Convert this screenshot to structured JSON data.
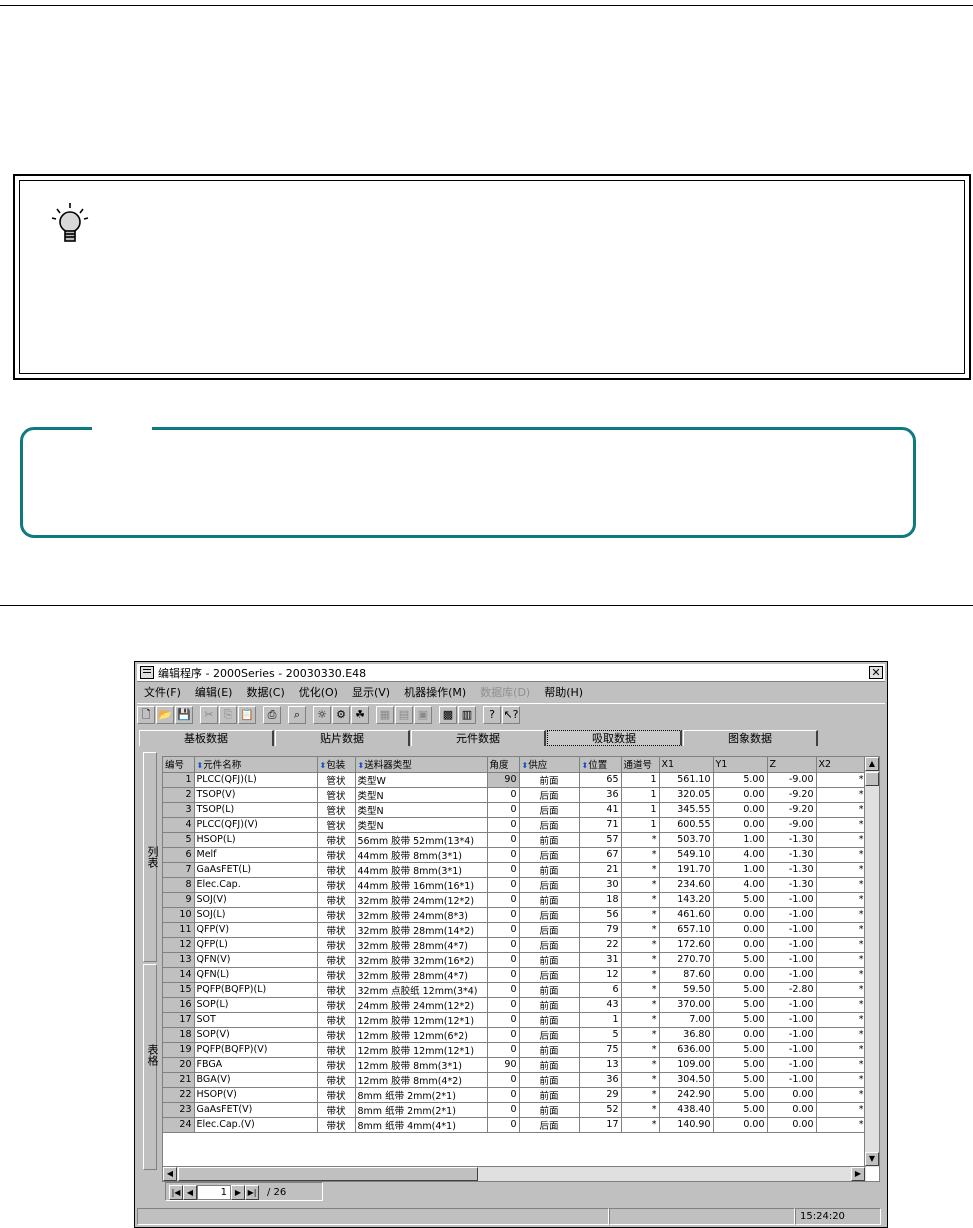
{
  "window": {
    "title": "编辑程序 - 2000Series - 20030330.E48",
    "close_label": "✕"
  },
  "menu": [
    {
      "label": "文件(F)",
      "enabled": true
    },
    {
      "label": "编辑(E)",
      "enabled": true
    },
    {
      "label": "数据(C)",
      "enabled": true
    },
    {
      "label": "优化(O)",
      "enabled": true
    },
    {
      "label": "显示(V)",
      "enabled": true
    },
    {
      "label": "机器操作(M)",
      "enabled": true
    },
    {
      "label": "数据库(D)",
      "enabled": false
    },
    {
      "label": "帮助(H)",
      "enabled": true
    }
  ],
  "toolbar": [
    {
      "name": "new-file-icon",
      "glyph": "🗋",
      "enabled": true
    },
    {
      "name": "open-folder-icon",
      "glyph": "📂",
      "enabled": true
    },
    {
      "name": "save-icon",
      "glyph": "💾",
      "enabled": true
    },
    {
      "sep": true
    },
    {
      "name": "cut-icon",
      "glyph": "✂",
      "enabled": false
    },
    {
      "name": "copy-icon",
      "glyph": "⎘",
      "enabled": false
    },
    {
      "name": "paste-icon",
      "glyph": "📋",
      "enabled": false
    },
    {
      "sep": true
    },
    {
      "name": "print-icon",
      "glyph": "⎙",
      "enabled": true
    },
    {
      "sep": true
    },
    {
      "name": "find-icon",
      "glyph": "⌕",
      "enabled": true
    },
    {
      "sep": true
    },
    {
      "name": "idea-bulb-icon",
      "glyph": "☼",
      "enabled": true
    },
    {
      "name": "optimize-icon",
      "glyph": "⚙",
      "enabled": true
    },
    {
      "name": "group-icon",
      "glyph": "☘",
      "enabled": true
    },
    {
      "sep": true
    },
    {
      "name": "disabled-tool-1-icon",
      "glyph": "▦",
      "enabled": false
    },
    {
      "name": "disabled-tool-2-icon",
      "glyph": "▤",
      "enabled": false
    },
    {
      "name": "disabled-tool-3-icon",
      "glyph": "▣",
      "enabled": false
    },
    {
      "sep": true
    },
    {
      "name": "machine-icon",
      "glyph": "▩",
      "enabled": true
    },
    {
      "name": "layout-icon",
      "glyph": "▥",
      "enabled": true
    },
    {
      "sep": true
    },
    {
      "name": "help-icon",
      "glyph": "?",
      "enabled": true
    },
    {
      "name": "context-help-icon",
      "glyph": "↖?",
      "enabled": true
    }
  ],
  "tabs": [
    "基板数据",
    "贴片数据",
    "元件数据",
    "吸取数据",
    "图象数据"
  ],
  "active_tab": 3,
  "sidebar": {
    "top_label": "列表",
    "bottom_label": "表格"
  },
  "grid": {
    "columns": [
      "编号",
      "元件名称",
      "包装",
      "送料器类型",
      "角度",
      "供应",
      "位置",
      "通道号",
      "X1",
      "Y1",
      "Z",
      "X2"
    ],
    "sortable": [
      false,
      true,
      true,
      true,
      false,
      true,
      true,
      false,
      false,
      false,
      false,
      false
    ],
    "rows": [
      [
        "1",
        "PLCC(QFJ)(L)",
        "管状",
        "类型W",
        "90",
        "前面",
        "65",
        "1",
        "561.10",
        "5.00",
        "-9.00",
        "*"
      ],
      [
        "2",
        "TSOP(V)",
        "管状",
        "类型N",
        "0",
        "后面",
        "36",
        "1",
        "320.05",
        "0.00",
        "-9.20",
        "*"
      ],
      [
        "3",
        "TSOP(L)",
        "管状",
        "类型N",
        "0",
        "后面",
        "41",
        "1",
        "345.55",
        "0.00",
        "-9.20",
        "*"
      ],
      [
        "4",
        "PLCC(QFJ)(V)",
        "管状",
        "类型N",
        "0",
        "后面",
        "71",
        "1",
        "600.55",
        "0.00",
        "-9.00",
        "*"
      ],
      [
        "5",
        "HSOP(L)",
        "带状",
        "56mm 胶带  52mm(13*4)",
        "0",
        "前面",
        "57",
        "*",
        "503.70",
        "1.00",
        "-1.30",
        "*"
      ],
      [
        "6",
        "Melf",
        "带状",
        "44mm 胶带  8mm(3*1)",
        "0",
        "后面",
        "67",
        "*",
        "549.10",
        "4.00",
        "-1.30",
        "*"
      ],
      [
        "7",
        "GaAsFET(L)",
        "带状",
        "44mm 胶带  8mm(3*1)",
        "0",
        "前面",
        "21",
        "*",
        "191.70",
        "1.00",
        "-1.30",
        "*"
      ],
      [
        "8",
        "Elec.Cap.",
        "带状",
        "44mm 胶带  16mm(16*1)",
        "0",
        "后面",
        "30",
        "*",
        "234.60",
        "4.00",
        "-1.30",
        "*"
      ],
      [
        "9",
        "SOJ(V)",
        "带状",
        "32mm 胶带  24mm(12*2)",
        "0",
        "前面",
        "18",
        "*",
        "143.20",
        "5.00",
        "-1.00",
        "*"
      ],
      [
        "10",
        "SOJ(L)",
        "带状",
        "32mm 胶带  24mm(8*3)",
        "0",
        "后面",
        "56",
        "*",
        "461.60",
        "0.00",
        "-1.00",
        "*"
      ],
      [
        "11",
        "QFP(V)",
        "带状",
        "32mm 胶带  28mm(14*2)",
        "0",
        "后面",
        "79",
        "*",
        "657.10",
        "0.00",
        "-1.00",
        "*"
      ],
      [
        "12",
        "QFP(L)",
        "带状",
        "32mm 胶带  28mm(4*7)",
        "0",
        "后面",
        "22",
        "*",
        "172.60",
        "0.00",
        "-1.00",
        "*"
      ],
      [
        "13",
        "QFN(V)",
        "带状",
        "32mm 胶带  32mm(16*2)",
        "0",
        "前面",
        "31",
        "*",
        "270.70",
        "5.00",
        "-1.00",
        "*"
      ],
      [
        "14",
        "QFN(L)",
        "带状",
        "32mm 胶带  28mm(4*7)",
        "0",
        "后面",
        "12",
        "*",
        "87.60",
        "0.00",
        "-1.00",
        "*"
      ],
      [
        "15",
        "PQFP(BQFP)(L)",
        "带状",
        "32mm 点胶纸  12mm(3*4)",
        "0",
        "前面",
        "6",
        "*",
        "59.50",
        "5.00",
        "-2.80",
        "*"
      ],
      [
        "16",
        "SOP(L)",
        "带状",
        "24mm 胶带  24mm(12*2)",
        "0",
        "前面",
        "43",
        "*",
        "370.00",
        "5.00",
        "-1.00",
        "*"
      ],
      [
        "17",
        "SOT",
        "带状",
        "12mm 胶带  12mm(12*1)",
        "0",
        "前面",
        "1",
        "*",
        "7.00",
        "5.00",
        "-1.00",
        "*"
      ],
      [
        "18",
        "SOP(V)",
        "带状",
        "12mm 胶带  12mm(6*2)",
        "0",
        "后面",
        "5",
        "*",
        "36.80",
        "0.00",
        "-1.00",
        "*"
      ],
      [
        "19",
        "PQFP(BQFP)(V)",
        "带状",
        "12mm 胶带  12mm(12*1)",
        "0",
        "前面",
        "75",
        "*",
        "636.00",
        "5.00",
        "-1.00",
        "*"
      ],
      [
        "20",
        "FBGA",
        "带状",
        "12mm 胶带  8mm(3*1)",
        "90",
        "前面",
        "13",
        "*",
        "109.00",
        "5.00",
        "-1.00",
        "*"
      ],
      [
        "21",
        "BGA(V)",
        "带状",
        "12mm 胶带  8mm(4*2)",
        "0",
        "前面",
        "36",
        "*",
        "304.50",
        "5.00",
        "-1.00",
        "*"
      ],
      [
        "22",
        "HSOP(V)",
        "带状",
        "8mm 纸带  2mm(2*1)",
        "0",
        "前面",
        "29",
        "*",
        "242.90",
        "5.00",
        "0.00",
        "*"
      ],
      [
        "23",
        "GaAsFET(V)",
        "带状",
        "8mm 纸带  2mm(2*1)",
        "0",
        "前面",
        "52",
        "*",
        "438.40",
        "5.00",
        "0.00",
        "*"
      ],
      [
        "24",
        "Elec.Cap.(V)",
        "带状",
        "8mm 纸带  4mm(4*1)",
        "0",
        "后面",
        "17",
        "*",
        "140.90",
        "0.00",
        "0.00",
        "*"
      ]
    ]
  },
  "pager": {
    "current": "1",
    "total": "/ 26"
  },
  "status": {
    "time": "15:24:20"
  }
}
